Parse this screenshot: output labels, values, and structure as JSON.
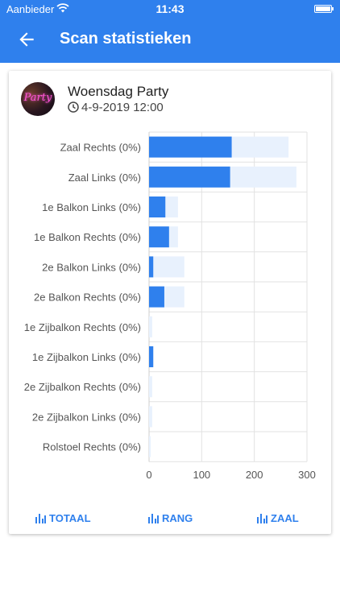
{
  "status_bar": {
    "carrier": "Aanbieder",
    "time": "11:43"
  },
  "header": {
    "title": "Scan statistieken"
  },
  "event": {
    "name": "Woensdag Party",
    "date": "4-9-2019 12:00",
    "avatar_text": "Party"
  },
  "chart_data": {
    "type": "bar",
    "orientation": "horizontal",
    "categories": [
      "Zaal Rechts (0%)",
      "Zaal Links (0%)",
      "1e Balkon Links (0%)",
      "1e Balkon Rechts (0%)",
      "2e Balkon Links (0%)",
      "2e Balkon Rechts (0%)",
      "1e Zijbalkon Rechts (0%)",
      "1e Zijbalkon Links (0%)",
      "2e Zijbalkon Rechts (0%)",
      "2e Zijbalkon Links (0%)",
      "Rolstoel Rechts (0%)"
    ],
    "series": [
      {
        "values": [
          265,
          280,
          55,
          55,
          67,
          67,
          6,
          8,
          6,
          6,
          3
        ],
        "color": "#e8f1fd"
      },
      {
        "values": [
          157,
          154,
          31,
          38,
          8,
          29,
          0,
          8,
          0,
          0,
          0
        ],
        "color": "#2f80ed"
      }
    ],
    "xticks": [
      0,
      100,
      200,
      300
    ],
    "xlim": [
      0,
      300
    ],
    "grid": true,
    "legend": "none"
  },
  "footer_buttons": [
    {
      "label": "TOTAAL",
      "icon": "bar-chart-icon"
    },
    {
      "label": "RANG",
      "icon": "bar-chart-icon"
    },
    {
      "label": "ZAAL",
      "icon": "bar-chart-icon"
    }
  ],
  "colors": {
    "primary": "#2f80ed",
    "secondary_bar": "#e8f1fd"
  }
}
